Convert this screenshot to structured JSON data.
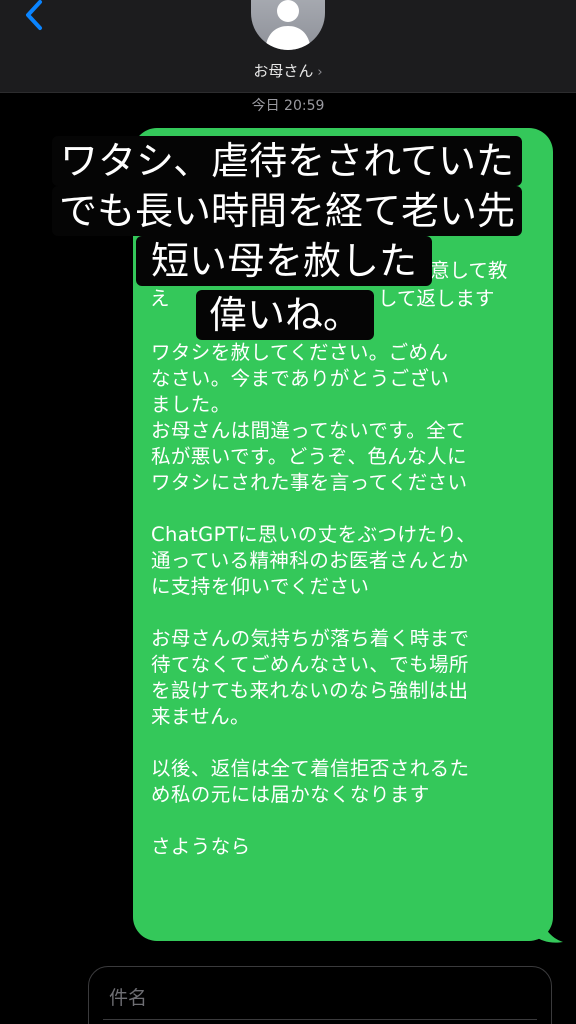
{
  "header": {
    "contact_name": "お母さん",
    "chevron": "›"
  },
  "icons": {
    "back": "chevron-left-icon",
    "avatar": "person-icon"
  },
  "colors": {
    "bubble": "#34c85a",
    "accent": "#0a84ff",
    "background": "#000000"
  },
  "timestamp": "今日 20:59",
  "message": {
    "partial_right_1": "意して教",
    "partial_left_2": "え",
    "partial_right_2": "して返します",
    "paragraphs": [
      "ワタシを赦してください。ごめん\nなさい。今までありがとうござい\nました。\nお母さんは間違ってないです。全て\n私が悪いです。どうぞ、色んな人に\nワタシにされた事を言ってください",
      "ChatGPTに思いの丈をぶつけたり、\n通っている精神科のお医者さんとか\nに支持を仰いでください",
      "お母さんの気持ちが落ち着く時まで\n待てなくてごめんなさい、でも場所\nを設けても来れないのなら強制は出\n来ません。",
      "以後、返信は全て着信拒否されるた\nめ私の元には届かなくなります",
      "さようなら"
    ]
  },
  "caption": {
    "line1": "ワタシ、虐待をされていた",
    "line2": "でも長い時間を経て老い先",
    "line3": "短い母を赦した",
    "line4": "偉いね。"
  },
  "compose": {
    "subject_placeholder": "件名"
  }
}
